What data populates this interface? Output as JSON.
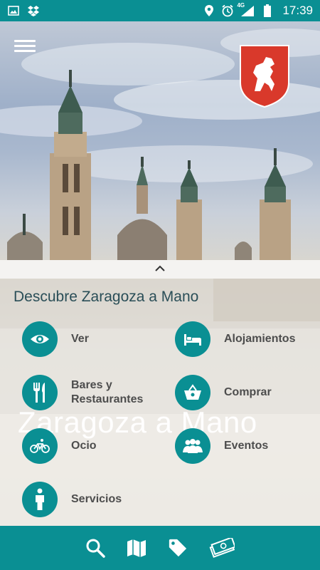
{
  "status_bar": {
    "icons": [
      "image-icon",
      "dropbox-icon",
      "location-icon",
      "alarm-icon",
      "signal-4g-icon",
      "battery-icon"
    ],
    "network": "4G",
    "time": "17:39"
  },
  "header": {
    "menu_icon": "hamburger-menu-icon",
    "crest_icon": "zaragoza-crest-icon"
  },
  "panel": {
    "title": "Descubre Zaragoza a Mano",
    "watermark": "Zaragoza a Mano",
    "categories": [
      {
        "label": "Ver",
        "icon": "eye-icon"
      },
      {
        "label": "Alojamientos",
        "icon": "bed-icon"
      },
      {
        "label": "Bares y Restaurantes",
        "icon": "fork-knife-icon"
      },
      {
        "label": "Comprar",
        "icon": "basket-icon"
      },
      {
        "label": "Ocio",
        "icon": "bicycle-icon"
      },
      {
        "label": "Eventos",
        "icon": "people-icon"
      },
      {
        "label": "Servicios",
        "icon": "person-icon"
      }
    ]
  },
  "bottom_bar": {
    "items": [
      "search-icon",
      "map-icon",
      "tag-icon",
      "money-icon"
    ]
  },
  "colors": {
    "accent": "#0a8f93",
    "crest_red": "#d9392b",
    "text_dark": "#4d4d4d",
    "title": "#2a4e57"
  }
}
